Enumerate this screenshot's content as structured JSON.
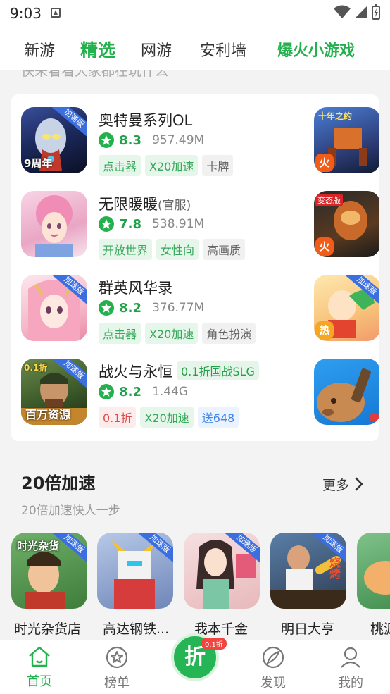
{
  "status_bar": {
    "time": "9:03",
    "icons": [
      "app-notification-icon",
      "wifi-icon",
      "signal-icon",
      "battery-icon"
    ]
  },
  "tabs": [
    {
      "label": "新游"
    },
    {
      "label": "精选",
      "active": true
    },
    {
      "label": "网游"
    },
    {
      "label": "安利墙"
    },
    {
      "label": "爆火小游戏"
    }
  ],
  "cut_hint": "快来看看大家都在玩什么",
  "featured_games": [
    {
      "name": "奥特曼系列OL",
      "sub": "",
      "promo": "",
      "speed_badge": "加速版",
      "rating": "8.3",
      "size": "957.49M",
      "tags": [
        {
          "text": "点击器",
          "style": "green"
        },
        {
          "text": "X20加速",
          "style": "green"
        },
        {
          "text": "卡牌",
          "style": "grey"
        }
      ],
      "icon_overlay": "9周年"
    },
    {
      "name": "无限暖暖",
      "sub": "(官服)",
      "promo": "",
      "speed_badge": "",
      "rating": "7.8",
      "size": "538.91M",
      "tags": [
        {
          "text": "开放世界",
          "style": "green"
        },
        {
          "text": "女性向",
          "style": "green"
        },
        {
          "text": "高画质",
          "style": "grey"
        }
      ],
      "icon_overlay": ""
    },
    {
      "name": "群英风华录",
      "sub": "",
      "promo": "",
      "speed_badge": "加速版",
      "rating": "8.2",
      "size": "376.77M",
      "tags": [
        {
          "text": "点击器",
          "style": "green"
        },
        {
          "text": "X20加速",
          "style": "green"
        },
        {
          "text": "角色扮演",
          "style": "grey"
        }
      ],
      "icon_overlay": ""
    },
    {
      "name": "战火与永恒",
      "sub": "",
      "promo": "0.1折国战SLG",
      "speed_badge": "加速版",
      "rating": "8.2",
      "size": "1.44G",
      "tags": [
        {
          "text": "0.1折",
          "style": "red"
        },
        {
          "text": "X20加速",
          "style": "green"
        },
        {
          "text": "送648",
          "style": "blue"
        }
      ],
      "icon_overlay": "百万资源",
      "icon_corner": "0.1折"
    }
  ],
  "side_games": [
    {
      "badge": "火",
      "badge_color": "#f25c19",
      "overlay": "十年之约"
    },
    {
      "badge": "火",
      "badge_color": "#f25c19",
      "overlay": "变态版"
    },
    {
      "badge": "热",
      "badge_color": "#f5a623",
      "overlay": "加速版"
    },
    {
      "badge": "",
      "badge_color": "#e03c3c",
      "overlay": ""
    }
  ],
  "section": {
    "title": "20倍加速",
    "subtitle": "20倍加速快人一步",
    "more_label": "更多",
    "games": [
      {
        "name": "时光杂货店",
        "badge": "加速版",
        "overlay": "时光杂货"
      },
      {
        "name": "高达钢铁...",
        "badge": "加速版",
        "overlay": ""
      },
      {
        "name": "我本千金",
        "badge": "加速版",
        "overlay": ""
      },
      {
        "name": "明日大亨",
        "badge": "加速版",
        "overlay": "烧烤"
      },
      {
        "name": "桃源",
        "badge": "",
        "overlay": ""
      }
    ]
  },
  "bottom_nav": [
    {
      "label": "首页",
      "icon": "home-icon",
      "active": true
    },
    {
      "label": "榜单",
      "icon": "ranking-star-icon"
    },
    {
      "label": "折",
      "icon": "discount-icon",
      "badge": "0.1折"
    },
    {
      "label": "发现",
      "icon": "discover-icon"
    },
    {
      "label": "我的",
      "icon": "profile-icon"
    }
  ],
  "colors": {
    "accent": "#22b14c",
    "speed_ribbon": "#3b6fe0",
    "hot_badge": "#f25c19"
  }
}
